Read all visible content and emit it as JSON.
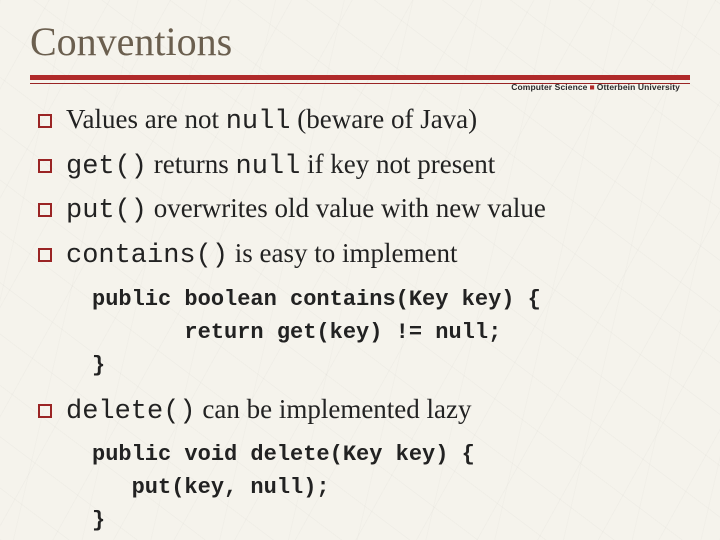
{
  "title": "Conventions",
  "affiliation": {
    "left": "Computer Science",
    "right": "Otterbein University"
  },
  "bullets": [
    {
      "pre": "Values are not ",
      "code": "null",
      "post": " (beware of Java)"
    },
    {
      "pre": "",
      "code": "get()",
      "post": " returns ",
      "code2": "null",
      "post2": " if key not present"
    },
    {
      "pre": "",
      "code": "put()",
      "post": " overwrites old value with new value"
    },
    {
      "pre": "",
      "code": "contains()",
      "post": " is easy to implement"
    }
  ],
  "code1": {
    "l1": "public boolean contains(Key key) {",
    "l2": "       return get(key) != null;",
    "l3": "}"
  },
  "bullet5": {
    "pre": "",
    "code": "delete()",
    "post": " can be implemented lazy"
  },
  "code2": {
    "l1": "public void delete(Key key) {",
    "l2": "   put(key, null);",
    "l3": "}"
  }
}
